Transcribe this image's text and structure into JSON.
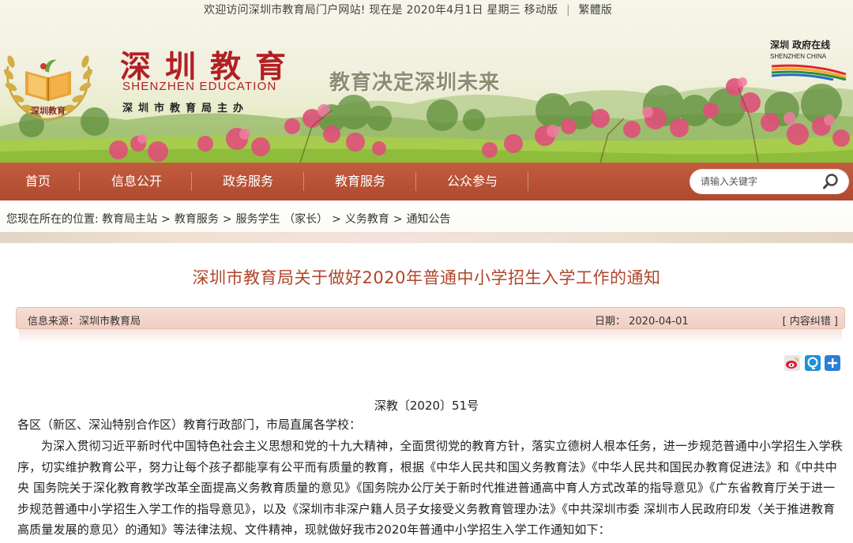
{
  "topbar": {
    "welcome": "欢迎访问深圳市教育局门户网站! 现在是 2020年4月1日 星期三",
    "mobile": "移动版",
    "traditional": "繁體版"
  },
  "header": {
    "badge_text": "深圳教育",
    "title": "深圳教育",
    "title_en": "SHENZHEN EDUCATION",
    "subtitle": "深圳市教育局主办",
    "slogan": "教育决定深圳未来",
    "city_logo_cn": "深圳 政府在线",
    "city_logo_en": "SHENZHEN CHINA"
  },
  "nav": {
    "items": [
      {
        "label": "首页"
      },
      {
        "label": "信息公开"
      },
      {
        "label": "政务服务"
      },
      {
        "label": "教育服务"
      },
      {
        "label": "公众参与"
      }
    ],
    "search_placeholder": "请输入关键字"
  },
  "breadcrumb": {
    "prefix": "您现在所在的位置:",
    "items": [
      "教育局主站",
      "教育服务",
      "服务学生 （家长）",
      "义务教育",
      "通知公告"
    ],
    "separator": ">"
  },
  "article": {
    "title": "深圳市教育局关于做好2020年普通中小学招生入学工作的通知",
    "source": "信息来源：深圳市教育局",
    "date": "日期： 2020-04-01",
    "correction": "[ 内容纠错 ]",
    "share_icons": [
      "weibo-icon",
      "qzone-icon",
      "more-share-icon"
    ],
    "doc_number": "深教〔2020〕51号",
    "salutation": "各区（新区、深汕特别合作区）教育行政部门，市局直属各学校：",
    "paragraph": "为深入贯彻习近平新时代中国特色社会主义思想和党的十九大精神，全面贯彻党的教育方针，落实立德树人根本任务，进一步规范普通中小学招生入学秩序，切实维护教育公平，努力让每个孩子都能享有公平而有质量的教育，根据《中华人民共和国义务教育法》《中华人民共和国民办教育促进法》和《中共中央 国务院关于深化教育教学改革全面提高义务教育质量的意见》《国务院办公厅关于新时代推进普通高中育人方式改革的指导意见》《广东省教育厅关于进一步规范普通中小学招生入学工作的指导意见》，以及《深圳市非深户籍人员子女接受义务教育管理办法》《中共深圳市委 深圳市人民政府印发〈关于推进教育高质量发展的意见〉的通知》等法律法规、文件精神，现就做好我市2020年普通中小学招生入学工作通知如下："
  },
  "colors": {
    "brand_red": "#b21f24",
    "nav_bg": "#b04a2f",
    "title_color": "#b0452b",
    "meta_bg": "#f3d4c8"
  }
}
